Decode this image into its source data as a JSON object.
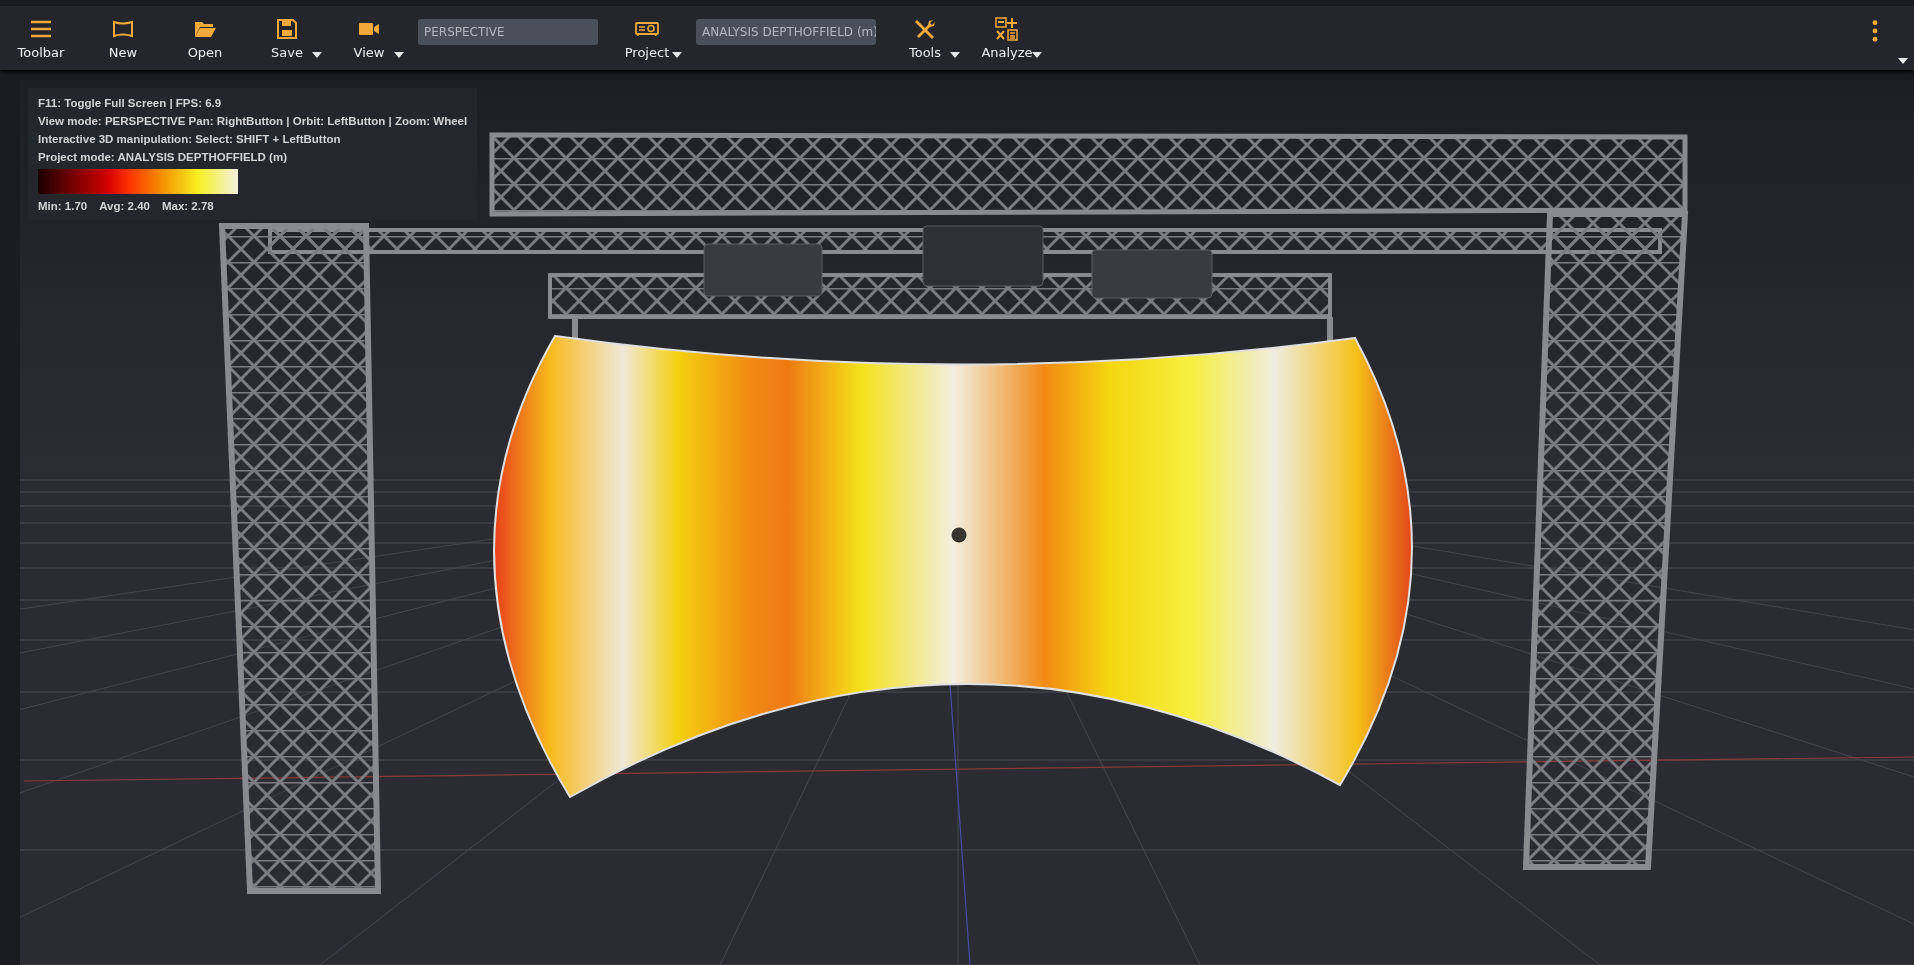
{
  "toolbar": {
    "items": [
      {
        "kind": "button",
        "label": "Toolbar",
        "dropdown": false
      },
      {
        "kind": "button",
        "label": "New",
        "dropdown": false
      },
      {
        "kind": "button",
        "label": "Open",
        "dropdown": false
      },
      {
        "kind": "button",
        "label": "Save",
        "dropdown": true
      },
      {
        "kind": "button",
        "label": "View",
        "dropdown": true
      },
      {
        "kind": "field",
        "value": "PERSPECTIVE"
      },
      {
        "kind": "button",
        "label": "Project",
        "dropdown": true
      },
      {
        "kind": "field",
        "value": "ANALYSIS DEPTHOFFIELD (m)"
      },
      {
        "kind": "button",
        "label": "Tools",
        "dropdown": true
      },
      {
        "kind": "button",
        "label": "Analyze",
        "dropdown": true
      }
    ]
  },
  "overlay": {
    "lines": [
      "F11: Toggle Full Screen | FPS: 6.9",
      "View mode: PERSPECTIVE Pan: RightButton | Orbit: LeftButton | Zoom: Wheel",
      "Interactive 3D manipulation: Select: SHIFT + LeftButton",
      "Project mode: ANALYSIS DEPTHOFFIELD (m)"
    ],
    "stats": [
      "Min: 1.70",
      "Avg: 2.40",
      "Max: 2.78"
    ]
  }
}
